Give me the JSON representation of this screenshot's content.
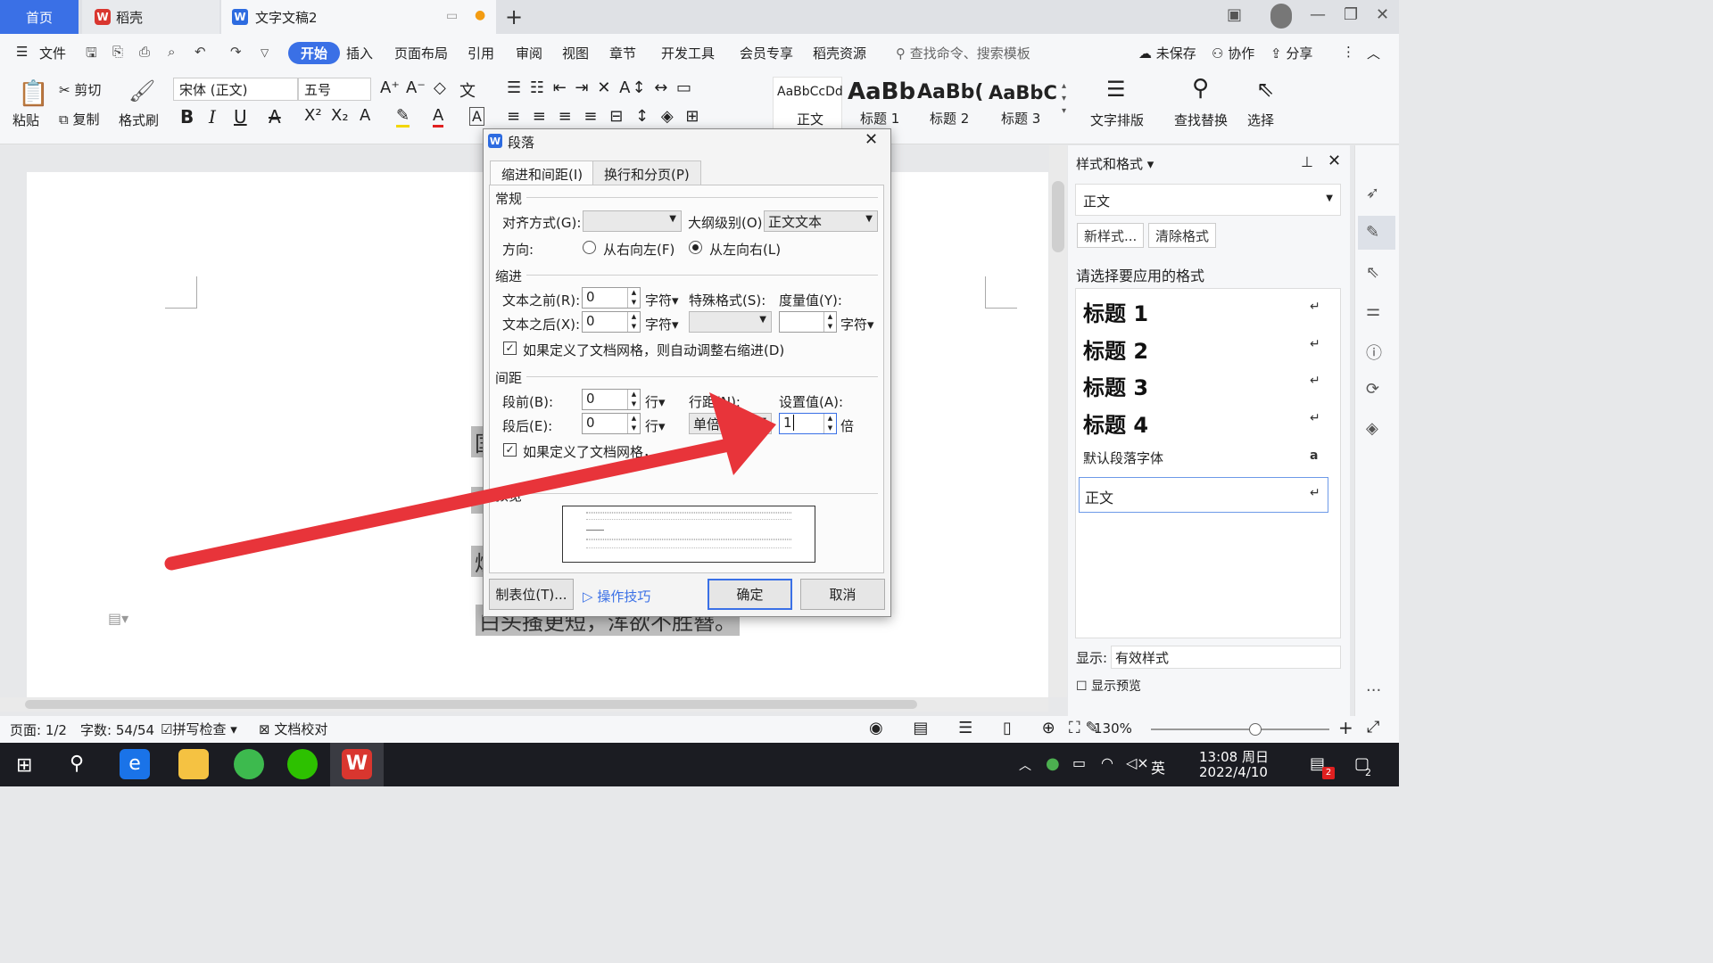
{
  "tabs": {
    "home": "首页",
    "daoke": "稻壳",
    "doc": "文字文稿2"
  },
  "menu": {
    "file": "文件",
    "items": [
      "开始",
      "插入",
      "页面布局",
      "引用",
      "审阅",
      "视图",
      "章节",
      "开发工具",
      "会员专享",
      "稻壳资源"
    ],
    "search": "查找命令、搜索模板",
    "unsaved": "未保存",
    "collab": "协作",
    "share": "分享"
  },
  "ribbon": {
    "paste": "粘贴",
    "cut": "剪切",
    "copy": "复制",
    "format_painter": "格式刷",
    "font": "宋体 (正文)",
    "size": "五号",
    "styles": [
      {
        "preview": "AaBbCcDd",
        "name": "正文"
      },
      {
        "preview": "AaBb",
        "name": "标题 1"
      },
      {
        "preview": "AaBb(",
        "name": "标题 2"
      },
      {
        "preview": "AaBbC",
        "name": "标题 3"
      }
    ],
    "text_layout": "文字排版",
    "find_replace": "查找替换",
    "select": "选择"
  },
  "document": {
    "line1": "国",
    "line2": "烛",
    "line3": "白头搔更短，浑欲不胜簪。"
  },
  "dialog": {
    "title": "段落",
    "tab1": "缩进和间距(I)",
    "tab2": "换行和分页(P)",
    "general": "常规",
    "align_label": "对齐方式(G):",
    "outline_label": "大纲级别(O):",
    "outline_value": "正文文本",
    "direction_label": "方向:",
    "rtl": "从右向左(F)",
    "ltr": "从左向右(L)",
    "indent": "缩进",
    "before_text": "文本之前(R):",
    "after_text": "文本之后(X):",
    "before_text_val": "0",
    "after_text_val": "0",
    "char_unit": "字符",
    "special": "特殊格式(S):",
    "measure": "度量值(Y):",
    "grid_indent": "如果定义了文档网格，则自动调整右缩进(D)",
    "spacing": "间距",
    "before_para": "段前(B):",
    "after_para": "段后(E):",
    "before_para_val": "0",
    "after_para_val": "0",
    "line_unit": "行",
    "line_spacing": "行距(N):",
    "line_spacing_val": "单倍行",
    "set_value": "设置值(A):",
    "set_value_val": "1",
    "times": "倍",
    "grid_snap": "如果定义了文档网格，",
    "preview": "预览",
    "tabs_btn": "制表位(T)...",
    "tips": "操作技巧",
    "ok": "确定",
    "cancel": "取消"
  },
  "panel": {
    "title": "样式和格式",
    "current": "正文",
    "new_style": "新样式...",
    "clear": "清除格式",
    "choose": "请选择要应用的格式",
    "items": [
      "标题  1",
      "标题  2",
      "标题  3",
      "标题  4"
    ],
    "default_font": "默认段落字体",
    "normal": "正文",
    "show_label": "显示:",
    "show_value": "有效样式",
    "preview_label": "显示预览"
  },
  "status": {
    "page": "页面: 1/2",
    "words": "字数: 54/54",
    "spell": "拼写检查",
    "proof": "文档校对",
    "zoom": "130%"
  },
  "taskbar": {
    "ime": "英",
    "time": "13:08 周日",
    "date": "2022/4/10",
    "notif": "2"
  },
  "colors": {
    "accent": "#3a70e6",
    "arrow": "#e8343a",
    "wps_red": "#d9362f"
  }
}
